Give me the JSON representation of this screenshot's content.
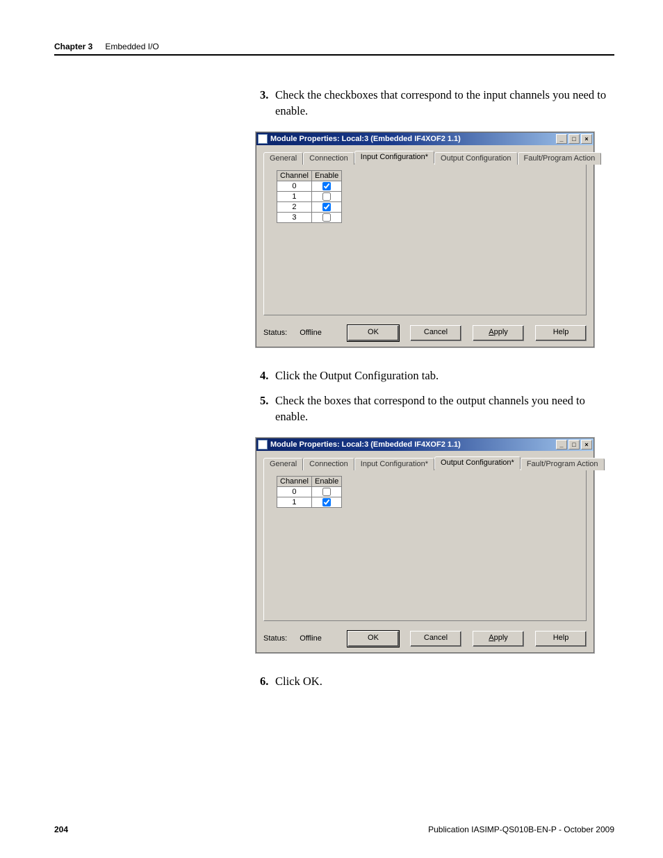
{
  "header": {
    "chapter": "Chapter 3",
    "section": "Embedded I/O"
  },
  "steps": {
    "s3": {
      "num": "3.",
      "text": "Check the checkboxes that correspond to the input channels you need to enable."
    },
    "s4": {
      "num": "4.",
      "text": "Click the Output Configuration tab."
    },
    "s5": {
      "num": "5.",
      "text": "Check the boxes that correspond to the output channels you need to enable."
    },
    "s6": {
      "num": "6.",
      "text": "Click OK."
    }
  },
  "dialog1": {
    "title": "Module Properties: Local:3 (Embedded IF4XOF2 1.1)",
    "tabs": {
      "general": "General",
      "connection": "Connection",
      "input": "Input Configuration*",
      "output": "Output Configuration",
      "fault": "Fault/Program Action"
    },
    "table": {
      "headers": {
        "channel": "Channel",
        "enable": "Enable"
      },
      "rows": [
        {
          "ch": "0",
          "checked": true
        },
        {
          "ch": "1",
          "checked": false
        },
        {
          "ch": "2",
          "checked": true
        },
        {
          "ch": "3",
          "checked": false
        }
      ]
    },
    "status": {
      "label": "Status:",
      "value": "Offline"
    },
    "buttons": {
      "ok": "OK",
      "cancel": "Cancel",
      "apply": "pply",
      "apply_u": "A",
      "help": "Help"
    }
  },
  "dialog2": {
    "title": "Module Properties: Local:3 (Embedded IF4XOF2 1.1)",
    "tabs": {
      "general": "General",
      "connection": "Connection",
      "input": "Input Configuration*",
      "output": "Output Configuration*",
      "fault": "Fault/Program Action"
    },
    "table": {
      "headers": {
        "channel": "Channel",
        "enable": "Enable"
      },
      "rows": [
        {
          "ch": "0",
          "checked": false
        },
        {
          "ch": "1",
          "checked": true
        }
      ]
    },
    "status": {
      "label": "Status:",
      "value": "Offline"
    },
    "buttons": {
      "ok": "OK",
      "cancel": "Cancel",
      "apply": "pply",
      "apply_u": "A",
      "help": "Help"
    }
  },
  "footer": {
    "page": "204",
    "pub": "Publication IASIMP-QS010B-EN-P - October 2009"
  },
  "winbtn": {
    "min": "_",
    "max": "□",
    "close": "×"
  }
}
